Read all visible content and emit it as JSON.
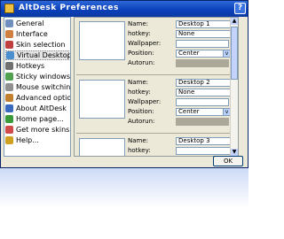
{
  "window": {
    "title": "AltDesk Preferences",
    "help_label": "?"
  },
  "sidebar": {
    "items": [
      {
        "label": "General",
        "icon": "gear-icon",
        "color": "#6f8fbf"
      },
      {
        "label": "Interface",
        "icon": "interface-icon",
        "color": "#d08040"
      },
      {
        "label": "Skin selection",
        "icon": "skin-icon",
        "color": "#c04040"
      },
      {
        "label": "Virtual Desktops",
        "icon": "desktops-icon",
        "color": "#4a8fd0"
      },
      {
        "label": "Hotkeys",
        "icon": "keyboard-icon",
        "color": "#707070"
      },
      {
        "label": "Sticky windows",
        "icon": "pin-icon",
        "color": "#50a050"
      },
      {
        "label": "Mouse switching",
        "icon": "mouse-icon",
        "color": "#909090"
      },
      {
        "label": "Advanced options",
        "icon": "advanced-icon",
        "color": "#c08030"
      },
      {
        "label": "About AltDesk",
        "icon": "about-icon",
        "color": "#3a6ac0"
      },
      {
        "label": "Home page...",
        "icon": "home-icon",
        "color": "#3a9a3a"
      },
      {
        "label": "Get more skins...",
        "icon": "skins-icon",
        "color": "#d04a4a"
      },
      {
        "label": "Help...",
        "icon": "help-icon",
        "color": "#d0a020"
      }
    ],
    "selected_index": 3
  },
  "labels": {
    "name": "Name:",
    "hotkey": "hotkey:",
    "wallpaper": "Wallpaper:",
    "position": "Position:",
    "autorun": "Autorun:",
    "browse": ">",
    "combo_arrow": "v"
  },
  "desktops": [
    {
      "name": "Desktop 1",
      "hotkey": "None",
      "wallpaper": "",
      "position": "Center",
      "autorun": ""
    },
    {
      "name": "Desktop 2",
      "hotkey": "None",
      "wallpaper": "",
      "position": "Center",
      "autorun": ""
    },
    {
      "name": "Desktop 3",
      "hotkey": "",
      "wallpaper": "",
      "position": "",
      "autorun": ""
    }
  ],
  "buttons": {
    "ok": "OK"
  },
  "scrollbar": {
    "up": "▲",
    "down": "▼"
  }
}
